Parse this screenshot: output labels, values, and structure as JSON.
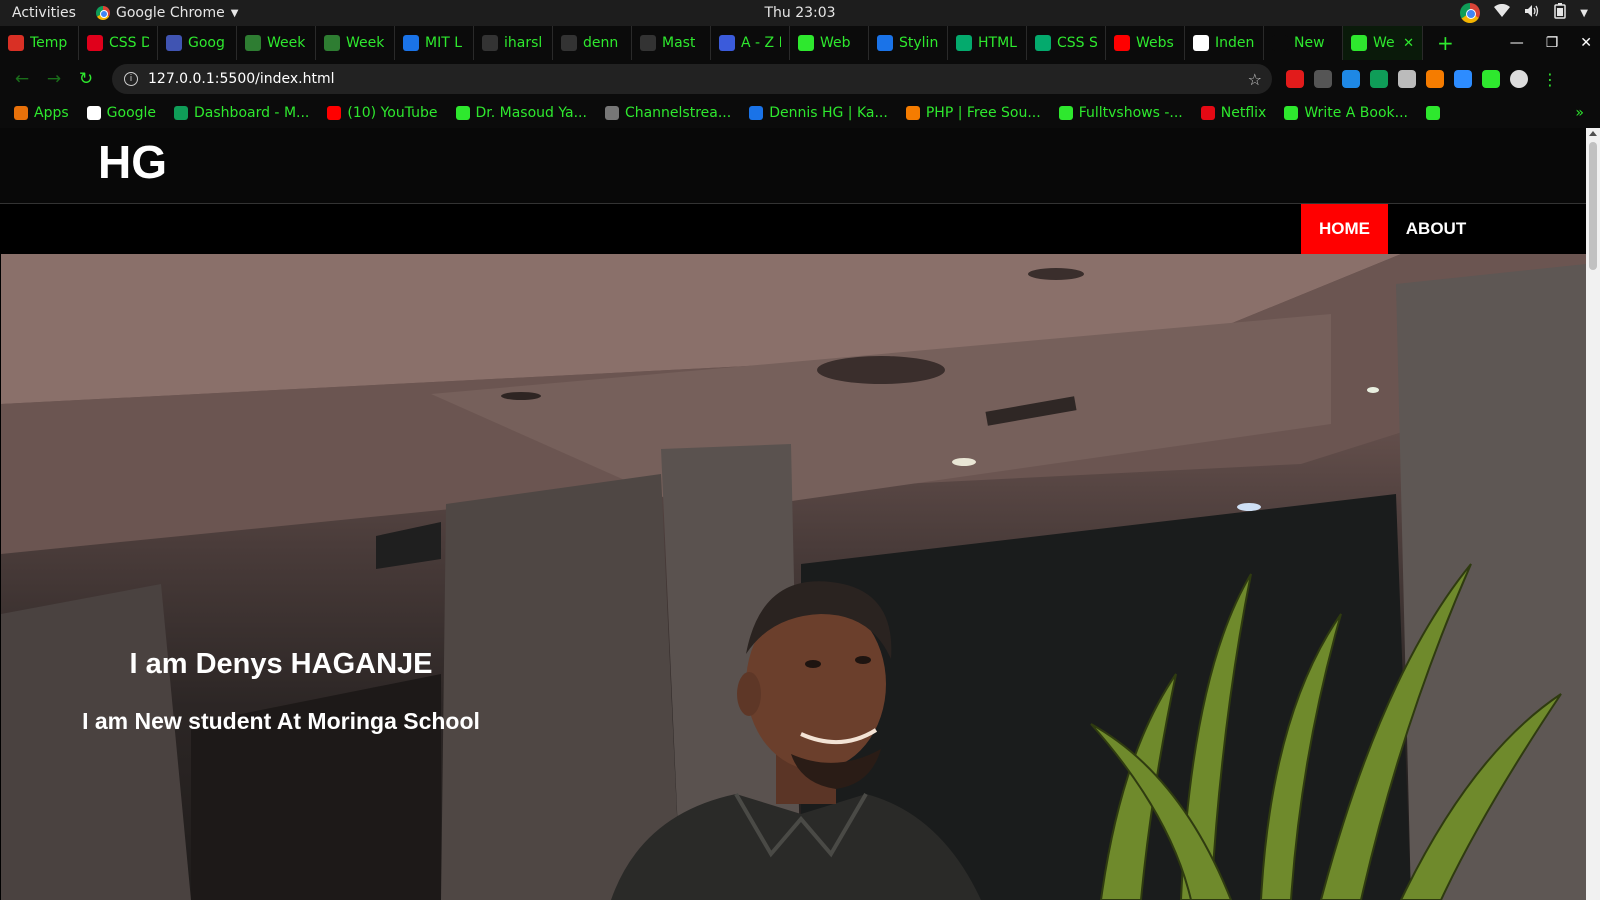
{
  "system": {
    "activities": "Activities",
    "app_name": "Google Chrome",
    "clock": "Thu 23:03"
  },
  "tabs": [
    {
      "label": "Temp",
      "icon": "gmail-icon",
      "color": "#d93025"
    },
    {
      "label": "CSS D",
      "icon": "opera-icon",
      "color": "#e0001b"
    },
    {
      "label": "Goog",
      "icon": "calendar-icon",
      "color": "#4054b2"
    },
    {
      "label": "Week",
      "icon": "plant-icon",
      "color": "#2e7d32"
    },
    {
      "label": "Week",
      "icon": "plant-icon",
      "color": "#2e7d32"
    },
    {
      "label": "MIT L",
      "icon": "help-icon",
      "color": "#1a73e8"
    },
    {
      "label": "iharsl",
      "icon": "github-icon",
      "color": "#333333"
    },
    {
      "label": "denn",
      "icon": "github-icon",
      "color": "#333333"
    },
    {
      "label": "Mast",
      "icon": "github-icon",
      "color": "#333333"
    },
    {
      "label": "A - Z L",
      "icon": "info-icon",
      "color": "#3b5bdb"
    },
    {
      "label": "Web",
      "icon": "globe-icon",
      "color": "#2ee82e"
    },
    {
      "label": "Stylin",
      "icon": "blue-box-icon",
      "color": "#1a73e8"
    },
    {
      "label": "HTML",
      "icon": "w3-icon",
      "color": "#04aa6d"
    },
    {
      "label": "CSS S",
      "icon": "w3-icon",
      "color": "#04aa6d"
    },
    {
      "label": "Webs",
      "icon": "youtube-icon",
      "color": "#ff0000"
    },
    {
      "label": "Inden",
      "icon": "google-icon",
      "color": "#ffffff"
    },
    {
      "label": "New",
      "icon": "blank-icon",
      "color": "#0b0b0b"
    },
    {
      "label": "We",
      "icon": "globe-icon",
      "color": "#2ee82e",
      "active": true
    }
  ],
  "toolbar": {
    "url": "127.0.0.1:5500/index.html",
    "info_icon": "info-icon",
    "star_icon": "star-icon"
  },
  "extensions": [
    {
      "name": "adblock-icon",
      "color": "#e21b1b"
    },
    {
      "name": "incognito-icon",
      "color": "#555555"
    },
    {
      "name": "iq-icon",
      "color": "#1e88e5"
    },
    {
      "name": "drive-icon",
      "color": "#0f9d58"
    },
    {
      "name": "cube-icon",
      "color": "#bbbbbb"
    },
    {
      "name": "pepper-icon",
      "color": "#f57c00"
    },
    {
      "name": "zoom-icon",
      "color": "#2d8cff"
    },
    {
      "name": "puzzle-icon",
      "color": "#2ee82e"
    },
    {
      "name": "profile-avatar",
      "color": "#dddddd"
    }
  ],
  "bookmarks": [
    {
      "label": "Apps",
      "icon": "apps-grid-icon",
      "color": "#e8710a"
    },
    {
      "label": "Google",
      "icon": "google-icon",
      "color": "#ffffff"
    },
    {
      "label": "Dashboard - M...",
      "icon": "dashboard-icon",
      "color": "#0f9d58"
    },
    {
      "label": "(10) YouTube",
      "icon": "youtube-icon",
      "color": "#ff0000"
    },
    {
      "label": "Dr. Masoud Ya...",
      "icon": "globe-icon",
      "color": "#2ee82e"
    },
    {
      "label": "Channelstrea...",
      "icon": "channel-icon",
      "color": "#777777"
    },
    {
      "label": "Dennis HG | Ka...",
      "icon": "k-icon",
      "color": "#1a73e8"
    },
    {
      "label": "PHP | Free Sou...",
      "icon": "php-icon",
      "color": "#f57c00"
    },
    {
      "label": "Fulltvshows -...",
      "icon": "globe-icon",
      "color": "#2ee82e"
    },
    {
      "label": "Netflix",
      "icon": "netflix-icon",
      "color": "#e50914"
    },
    {
      "label": "Write A Book...",
      "icon": "book-icon",
      "color": "#2ee82e"
    },
    {
      "label": "",
      "icon": "globe-icon",
      "color": "#2ee82e"
    }
  ],
  "bookmarks_more": "»",
  "site": {
    "logo_text": "HG",
    "nav": {
      "home": "HOME",
      "about": "ABOUT"
    },
    "hero": {
      "title": "I am Denys HAGANJE",
      "subtitle": "I am New student At Moringa School"
    },
    "accent_color": "#ff0000"
  }
}
